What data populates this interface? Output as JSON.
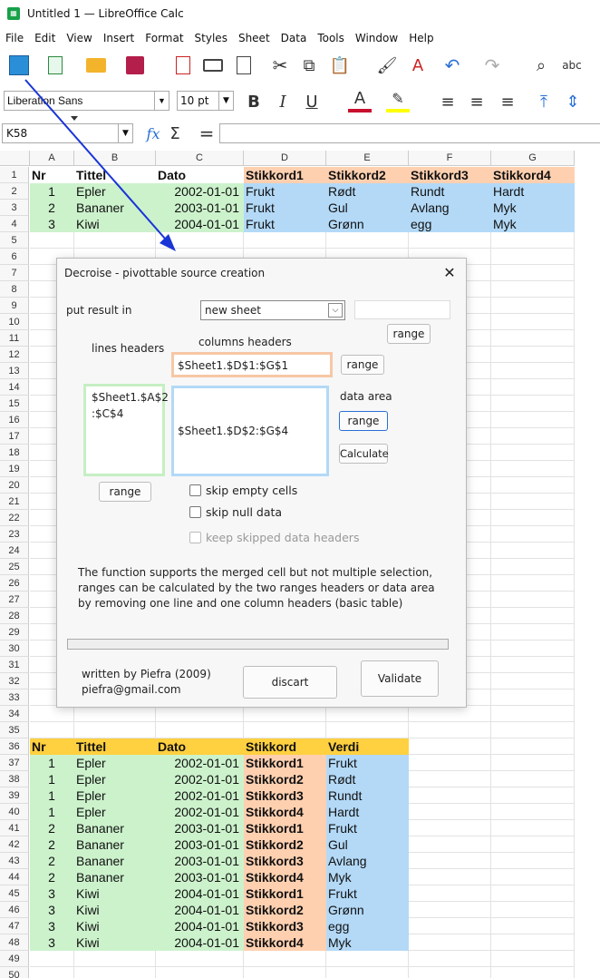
{
  "window": {
    "title": "Untitled 1 — LibreOffice Calc",
    "app_icon": "calc-icon"
  },
  "menu": [
    "File",
    "Edit",
    "View",
    "Insert",
    "Format",
    "Styles",
    "Sheet",
    "Data",
    "Tools",
    "Window",
    "Help"
  ],
  "toolbar": {
    "font_name": "Liberation Sans",
    "font_size": "10 pt",
    "spellcheck_label": "abc"
  },
  "formula_bar": {
    "cell_ref": "K58",
    "formula": ""
  },
  "columns": [
    "A",
    "B",
    "C",
    "D",
    "E",
    "F",
    "G"
  ],
  "rows": [
    "1",
    "2",
    "3",
    "4",
    "5",
    "6",
    "7",
    "8",
    "9",
    "10",
    "11",
    "12",
    "13",
    "14",
    "15",
    "16",
    "17",
    "18",
    "19",
    "20",
    "21",
    "22",
    "23",
    "24",
    "25",
    "26",
    "27",
    "28",
    "29",
    "30",
    "31",
    "32",
    "33",
    "34",
    "35",
    "36",
    "37",
    "38",
    "39",
    "40",
    "41",
    "42",
    "43",
    "44",
    "45",
    "46",
    "47",
    "48",
    "49",
    "50"
  ],
  "source_table": {
    "headers": [
      "Nr",
      "Tittel",
      "Dato",
      "Stikkord1",
      "Stikkord2",
      "Stikkord3",
      "Stikkord4"
    ],
    "rows": [
      [
        "1",
        "Epler",
        "2002-01-01",
        "Frukt",
        "Rødt",
        "Rundt",
        "Hardt"
      ],
      [
        "2",
        "Bananer",
        "2003-01-01",
        "Frukt",
        "Gul",
        "Avlang",
        "Myk"
      ],
      [
        "3",
        "Kiwi",
        "2004-01-01",
        "Frukt",
        "Grønn",
        "egg",
        "Myk"
      ]
    ]
  },
  "result_table": {
    "headers": [
      "Nr",
      "Tittel",
      "Dato",
      "Stikkord",
      "Verdi"
    ],
    "rows": [
      [
        "1",
        "Epler",
        "2002-01-01",
        "Stikkord1",
        "Frukt"
      ],
      [
        "1",
        "Epler",
        "2002-01-01",
        "Stikkord2",
        "Rødt"
      ],
      [
        "1",
        "Epler",
        "2002-01-01",
        "Stikkord3",
        "Rundt"
      ],
      [
        "1",
        "Epler",
        "2002-01-01",
        "Stikkord4",
        "Hardt"
      ],
      [
        "2",
        "Bananer",
        "2003-01-01",
        "Stikkord1",
        "Frukt"
      ],
      [
        "2",
        "Bananer",
        "2003-01-01",
        "Stikkord2",
        "Gul"
      ],
      [
        "2",
        "Bananer",
        "2003-01-01",
        "Stikkord3",
        "Avlang"
      ],
      [
        "2",
        "Bananer",
        "2003-01-01",
        "Stikkord4",
        "Myk"
      ],
      [
        "3",
        "Kiwi",
        "2004-01-01",
        "Stikkord1",
        "Frukt"
      ],
      [
        "3",
        "Kiwi",
        "2004-01-01",
        "Stikkord2",
        "Grønn"
      ],
      [
        "3",
        "Kiwi",
        "2004-01-01",
        "Stikkord3",
        "egg"
      ],
      [
        "3",
        "Kiwi",
        "2004-01-01",
        "Stikkord4",
        "Myk"
      ]
    ]
  },
  "colors": {
    "green": "#ccf2cc",
    "orange": "#ffd0b0",
    "blue": "#b3d9f7",
    "yellow": "#ffd040",
    "arrow": "#1a35d6"
  },
  "dialog": {
    "title": "Decroise - pivottable source creation",
    "put_result_label": "put result in",
    "result_select": "new sheet",
    "result_input": "",
    "range_label": "range",
    "lines_headers_label": "lines headers",
    "columns_headers_label": "columns headers",
    "columns_headers_value": "$Sheet1.$D$1:$G$1",
    "lines_headers_value": "$Sheet1.$A$2\n:$C$4",
    "data_area_label": "data area",
    "data_area_value": "$Sheet1.$D$2:$G$4",
    "calculate_label": "Calculate",
    "skip_empty": "skip empty cells",
    "skip_null": "skip null data",
    "keep_skipped": "keep skipped data headers",
    "note": "The function supports the merged cell but not multiple selection, ranges can be calculated by the two ranges headers or data area by removing one line and one column headers (basic table)",
    "author_line1": "written by Piefra (2009)",
    "author_line2": "piefra@gmail.com",
    "discart_label": "discart",
    "validate_label": "Validate"
  }
}
